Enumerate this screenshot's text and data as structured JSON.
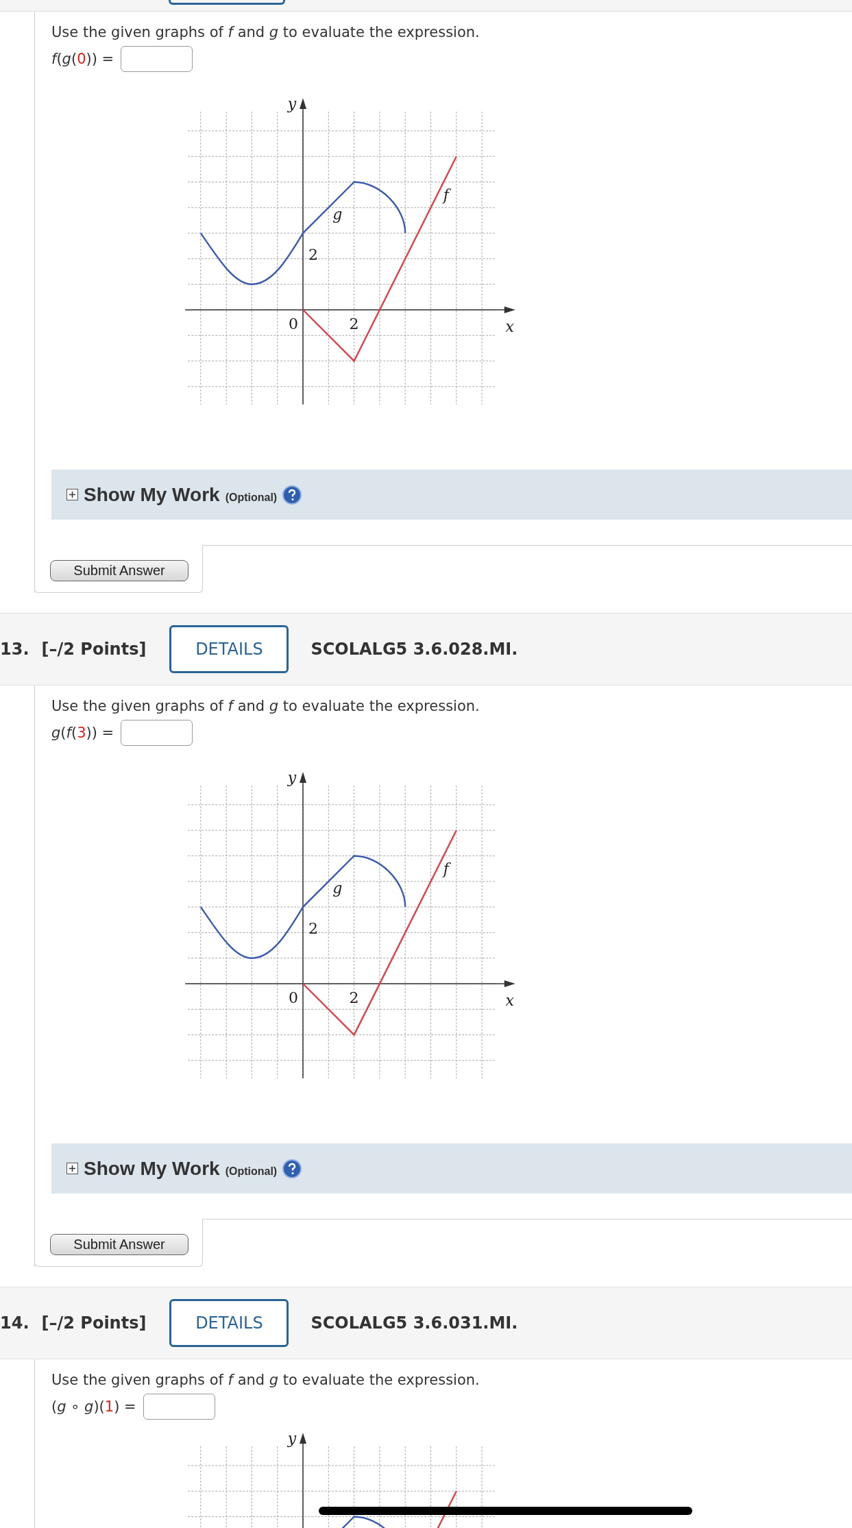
{
  "questions": [
    {
      "prompt": "Use the given graphs of *f* and *g* to evaluate the expression.",
      "expression": [
        {
          "kind": "var",
          "text": "f"
        },
        {
          "kind": "sym",
          "text": "("
        },
        {
          "kind": "var",
          "text": "g"
        },
        {
          "kind": "sym",
          "text": "("
        },
        {
          "kind": "num",
          "text": "0"
        },
        {
          "kind": "sym",
          "text": ")) ="
        }
      ],
      "graph": {
        "y_label": "y",
        "x_label": "x",
        "origin_label": "0",
        "x_tick_label": "2",
        "y_tick_label": "2",
        "g_label": "g",
        "f_label": "f"
      },
      "show_work": {
        "label": "Show My Work",
        "note": "(Optional)",
        "expanded": false
      },
      "submit_label": "Submit Answer"
    },
    {
      "number": "13.",
      "points": "[–/2 Points]",
      "details": "DETAILS",
      "code": "SCOLALG5 3.6.028.MI.",
      "prompt": "Use the given graphs of *f* and *g* to evaluate the expression.",
      "expression": [
        {
          "kind": "var",
          "text": "g"
        },
        {
          "kind": "sym",
          "text": "("
        },
        {
          "kind": "var",
          "text": "f"
        },
        {
          "kind": "sym",
          "text": "("
        },
        {
          "kind": "num",
          "text": "3"
        },
        {
          "kind": "sym",
          "text": ")) ="
        }
      ],
      "graph": {
        "y_label": "y",
        "x_label": "x",
        "origin_label": "0",
        "x_tick_label": "2",
        "y_tick_label": "2",
        "g_label": "g",
        "f_label": "f"
      },
      "show_work": {
        "label": "Show My Work",
        "note": "(Optional)",
        "expanded": false
      },
      "submit_label": "Submit Answer"
    },
    {
      "number": "14.",
      "points": "[–/2 Points]",
      "details": "DETAILS",
      "code": "SCOLALG5 3.6.031.MI.",
      "prompt": "Use the given graphs of *f* and *g* to evaluate the expression.",
      "expression": [
        {
          "kind": "sym",
          "text": "("
        },
        {
          "kind": "var",
          "text": "g"
        },
        {
          "kind": "sym",
          "text": " ∘ "
        },
        {
          "kind": "var",
          "text": "g"
        },
        {
          "kind": "sym",
          "text": ")("
        },
        {
          "kind": "num",
          "text": "1"
        },
        {
          "kind": "sym",
          "text": ") ="
        }
      ],
      "graph": {
        "y_label": "y"
      }
    }
  ]
}
